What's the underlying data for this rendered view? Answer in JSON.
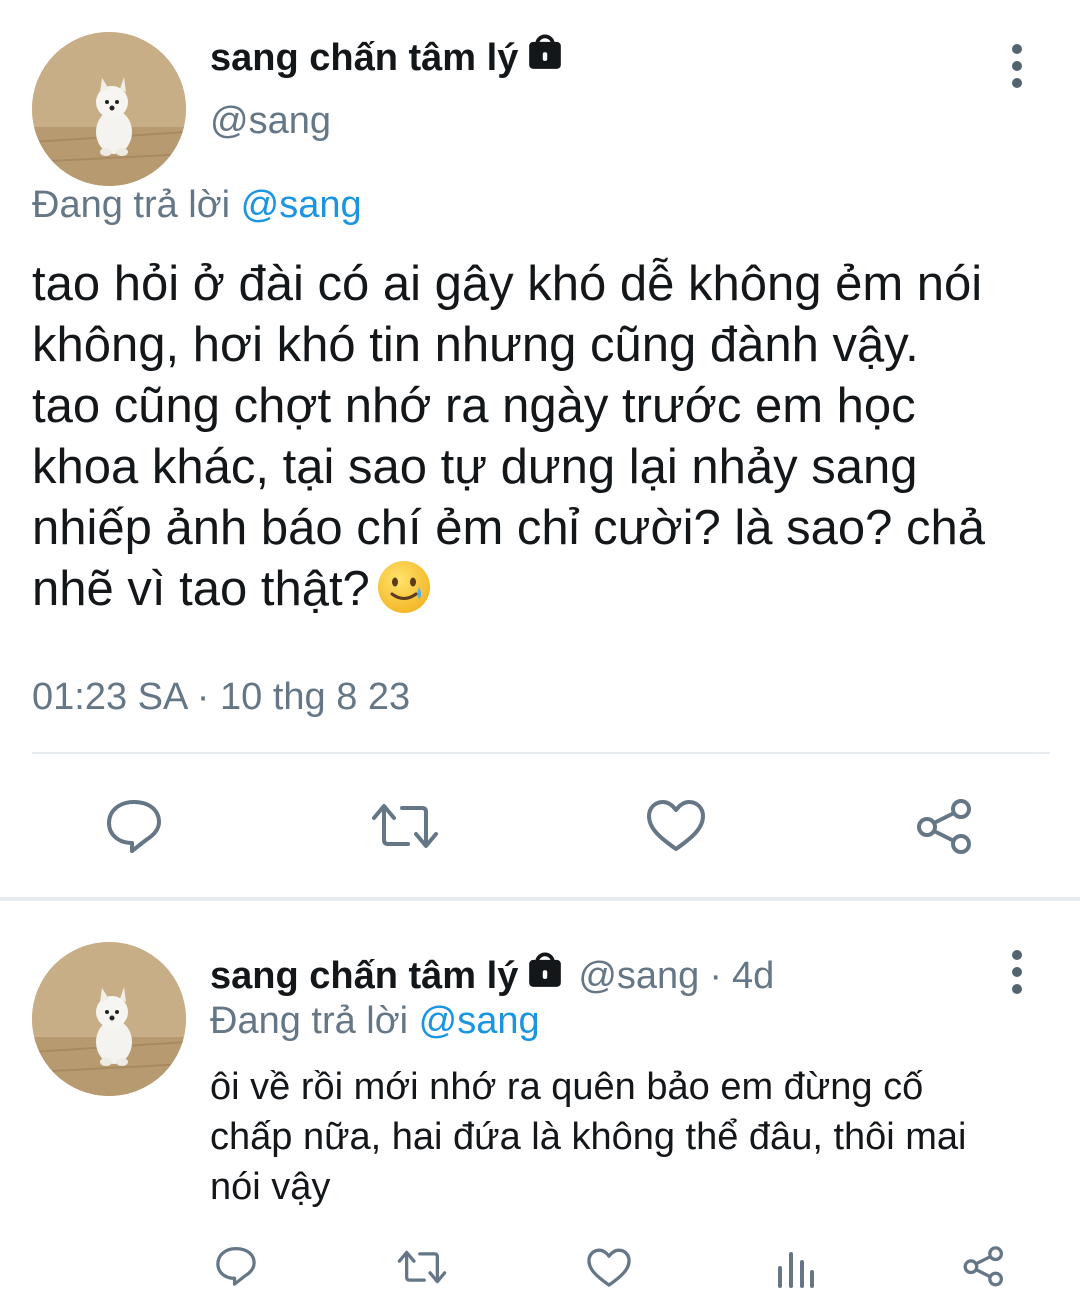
{
  "tweet": {
    "author_name": "sang chấn tâm lý",
    "author_handle": "@sang",
    "replying_prefix": "Đang trả lời",
    "replying_to": "@sang",
    "text_lines": [
      "tao hỏi ở đài có ai gây khó dễ không ẻm nói",
      "không, hơi khó tin nhưng cũng đành vậy.",
      "tao cũng chợt nhớ ra ngày trước em học",
      "khoa khác, tại sao tự dưng lại nhảy sang",
      "nhiếp ảnh báo chí ẻm chỉ cười? là sao? chả",
      "nhẽ vì tao thật?"
    ],
    "emoji": "smiling-face-with-tear",
    "timestamp": "01:23 SA · 10 thg 8 23",
    "actions": [
      "reply-icon",
      "retweet-icon",
      "like-icon",
      "share-icon"
    ]
  },
  "reply": {
    "author_name": "sang chấn tâm lý",
    "author_handle": "@sang",
    "age": "4d",
    "separator": "·",
    "replying_prefix": "Đang trả lời",
    "replying_to": "@sang",
    "text_lines": [
      "ôi về rồi mới nhớ ra quên bảo em đừng cố",
      "chấp nữa, hai đứa là không thể đâu, thôi mai",
      "nói vậy"
    ],
    "actions": [
      "reply-icon",
      "retweet-icon",
      "like-icon",
      "analytics-icon",
      "share-icon"
    ]
  },
  "colors": {
    "text": "#14171a",
    "secondary": "#657786",
    "link": "#1b95e0",
    "divider": "#e6ecf0"
  }
}
